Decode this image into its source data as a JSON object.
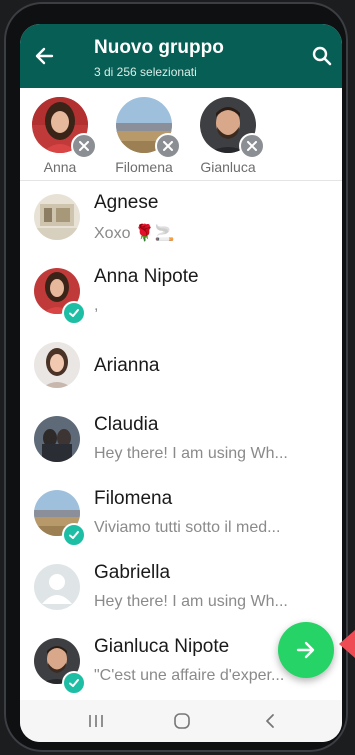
{
  "header": {
    "title": "Nuovo gruppo",
    "subtitle": "3 di 256 selezionati",
    "background": "#075e54"
  },
  "selected": [
    {
      "name": "Anna"
    },
    {
      "name": "Filomena"
    },
    {
      "name": "Gianluca"
    }
  ],
  "contacts": [
    {
      "name": "Agnese",
      "status": "Xoxo 🌹🚬",
      "selected": false
    },
    {
      "name": "Anna Nipote",
      "status": ",",
      "selected": true
    },
    {
      "name": "Arianna",
      "status": "",
      "selected": false
    },
    {
      "name": "Claudia",
      "status": "Hey there! I am using Wh...",
      "selected": false
    },
    {
      "name": "Filomena",
      "status": "Viviamo tutti sotto il med...",
      "selected": true
    },
    {
      "name": "Gabriella",
      "status": "Hey there! I am using Wh...",
      "selected": false
    },
    {
      "name": "Gianluca Nipote",
      "status": "\"C'est une affaire d'exper...",
      "selected": true
    }
  ],
  "colors": {
    "accent": "#25d366",
    "check": "#1ebea5",
    "header": "#075e54"
  },
  "icons": {
    "back": "arrow-left-icon",
    "search": "search-icon",
    "next": "arrow-right-icon",
    "remove": "close-icon"
  }
}
